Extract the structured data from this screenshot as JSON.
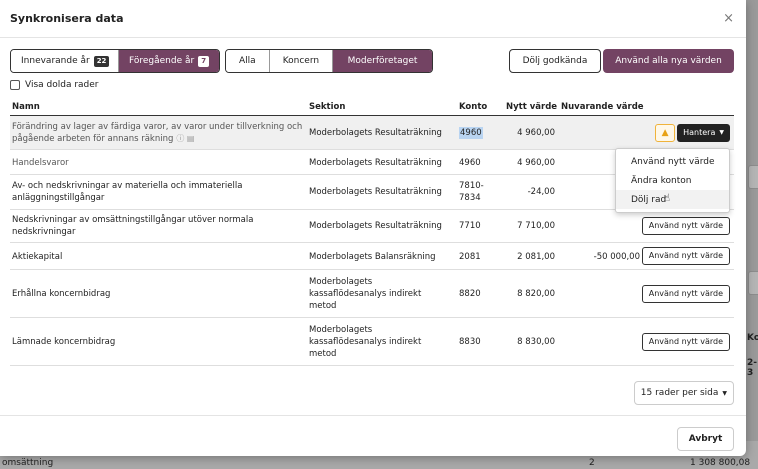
{
  "modal": {
    "title": "Synkronisera data",
    "close": "×"
  },
  "toolbar": {
    "period_tabs": [
      {
        "label": "Innevarande år",
        "count": "22",
        "active": false
      },
      {
        "label": "Föregående år",
        "count": "7",
        "active": true
      }
    ],
    "scope_tabs": [
      {
        "label": "Alla",
        "active": false
      },
      {
        "label": "Koncern",
        "active": false
      },
      {
        "label": "Moderföretaget",
        "active": true
      }
    ],
    "hide_approved": "Dölj godkända",
    "use_all_new": "Använd alla nya värden"
  },
  "show_hidden": {
    "label": "Visa dolda rader",
    "checked": false
  },
  "table": {
    "headers": {
      "name": "Namn",
      "section": "Sektion",
      "account": "Konto",
      "new_value": "Nytt värde",
      "current_value": "Nuvarande värde"
    },
    "rows": [
      {
        "name": "Förändring av lager av färdiga varor, av varor under tillverkning och pågående arbeten för annans räkning",
        "section": "Moderbolagets Resultaträkning",
        "account": "4960",
        "new_value": "4 960,00",
        "current_value": "",
        "action": "Hantera"
      },
      {
        "name": "Handelsvaror",
        "section": "Moderbolagets Resultaträkning",
        "account": "4960",
        "new_value": "4 960,00",
        "current_value": "",
        "action": ""
      },
      {
        "name": "Av- och nedskrivningar av materiella och immateriella anläggningstillgångar",
        "section": "Moderbolagets Resultaträkning",
        "account": "7810-7834",
        "new_value": "-24,00",
        "current_value": "",
        "action": ""
      },
      {
        "name": "Nedskrivningar av omsättningstillgångar utöver normala nedskrivningar",
        "section": "Moderbolagets Resultaträkning",
        "account": "7710",
        "new_value": "7 710,00",
        "current_value": "",
        "action": "Använd nytt värde"
      },
      {
        "name": "Aktiekapital",
        "section": "Moderbolagets Balansräkning",
        "account": "2081",
        "new_value": "2 081,00",
        "current_value": "-50 000,00",
        "action": "Använd nytt värde"
      },
      {
        "name": "Erhållna koncernbidrag",
        "section": "Moderbolagets kassaflödesanalys indirekt metod",
        "account": "8820",
        "new_value": "8 820,00",
        "current_value": "",
        "action": "Använd nytt värde"
      },
      {
        "name": "Lämnade koncernbidrag",
        "section": "Moderbolagets kassaflödesanalys indirekt metod",
        "account": "8830",
        "new_value": "8 830,00",
        "current_value": "",
        "action": "Använd nytt värde"
      }
    ]
  },
  "dropdown": {
    "items": [
      "Använd nytt värde",
      "Ändra konton",
      "Dölj rad"
    ]
  },
  "pager": {
    "label": "15 rader per sida"
  },
  "footer": {
    "cancel": "Avbryt"
  },
  "background": {
    "bottom_left": "omsättning",
    "bottom_mid": "2",
    "bottom_right": "1 308 800,08",
    "side_a": "Ko",
    "side_b": "2-3"
  }
}
